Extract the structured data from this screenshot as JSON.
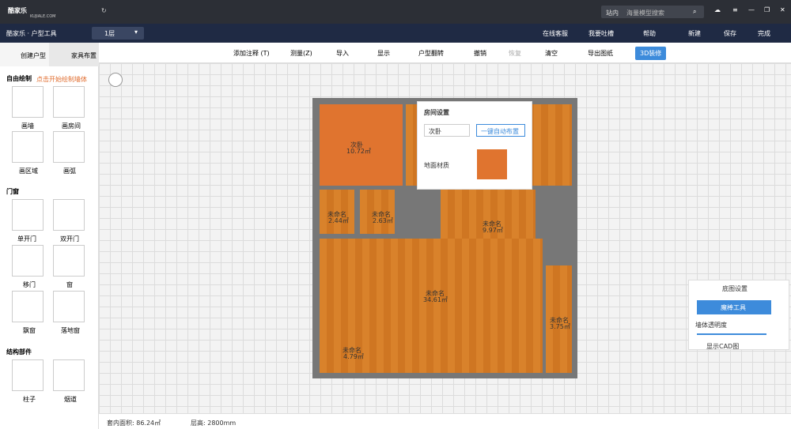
{
  "top": {
    "app_name": "酷家乐",
    "app_sub": "KUJIALE.COM",
    "search_scope": "站内",
    "search_placeholder": "海量模型搜索"
  },
  "second": {
    "title": "酷家乐 · 户型工具",
    "floor": "1层",
    "service": "在线客服",
    "feedback": "我要吐槽",
    "help": "帮助",
    "new": "新建",
    "save": "保存",
    "done": "完成"
  },
  "toolbar": {
    "annotate": "添加注释 (T)",
    "measure": "测量(Z)",
    "import": "导入",
    "display": "显示",
    "flip": "户型翻转",
    "undo": "撤销",
    "redo": "恢复",
    "clear": "清空",
    "export": "导出图纸",
    "decor": "3D装修"
  },
  "left": {
    "tab_create": "创建户型",
    "tab_furniture": "家具布置",
    "free_draw": "自由绘制",
    "draw_hint": "点击开始绘制墙体",
    "draw_wall": "画墙",
    "draw_room": "画房间",
    "draw_region": "画区域",
    "draw_arc": "画弧",
    "doors_windows": "门窗",
    "single_door": "单开门",
    "double_door": "双开门",
    "sliding_door": "移门",
    "window": "窗",
    "bay_window": "飘窗",
    "floor_window": "落地窗",
    "structural": "结构部件",
    "pillar": "柱子",
    "flue": "烟道"
  },
  "room_panel": {
    "title": "房间设置",
    "room_type": "次卧",
    "auto_layout": "一键自动布置",
    "floor_material": "地面材质"
  },
  "base_panel": {
    "title": "底图设置",
    "magic": "魔棒工具",
    "opacity": "墙体透明度",
    "cad": "显示CAD图"
  },
  "plan": {
    "bedroom": "次卧",
    "bedroom_area": "10.72㎡",
    "a1": "未命名",
    "a1a": "2.44㎡",
    "a2": "未命名",
    "a2a": "2.63㎡",
    "a3": "未命名",
    "a3a": "9.97㎡",
    "a4": "未命名",
    "a4a": "34.61㎡",
    "a5": "未命名",
    "a5a": "4.79㎡",
    "a6": "未命名",
    "a6a": "3.75㎡"
  },
  "status": {
    "area": "套内面积: 86.24㎡",
    "height": "层高: 2800mm"
  }
}
